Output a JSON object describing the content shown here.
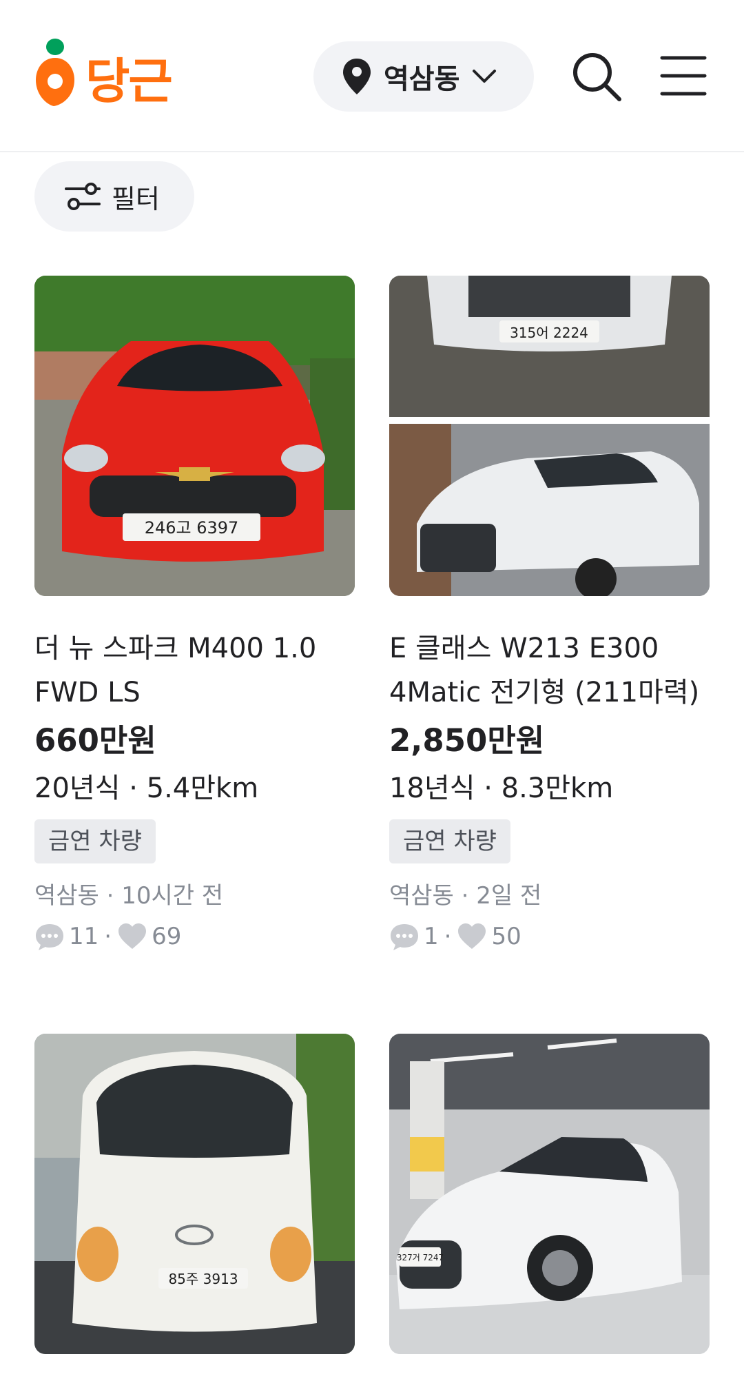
{
  "header": {
    "logo_text": "당근",
    "location": "역삼동"
  },
  "filter": {
    "label": "필터"
  },
  "listings": [
    {
      "title": "더 뉴 스파크 M400 1.0 FWD LS",
      "price": "660만원",
      "spec": "20년식 · 5.4만km",
      "badge": "금연 차량",
      "meta": "역삼동 · 10시간 전",
      "chats": "11",
      "likes": "69",
      "plate": "246고 6397"
    },
    {
      "title": "E 클래스 W213 E300 4Matic 전기형 (211마력)",
      "price": "2,850만원",
      "spec": "18년식 · 8.3만km",
      "badge": "금연 차량",
      "meta": "역삼동 · 2일 전",
      "chats": "1",
      "likes": "50",
      "plate": "315어 2224"
    },
    {
      "plate": "85주 3913"
    },
    {
      "plate": "327거 7247"
    }
  ],
  "colors": {
    "brand": "#ff6f0f",
    "pill_bg": "#f2f3f6",
    "muted": "#868b94"
  }
}
